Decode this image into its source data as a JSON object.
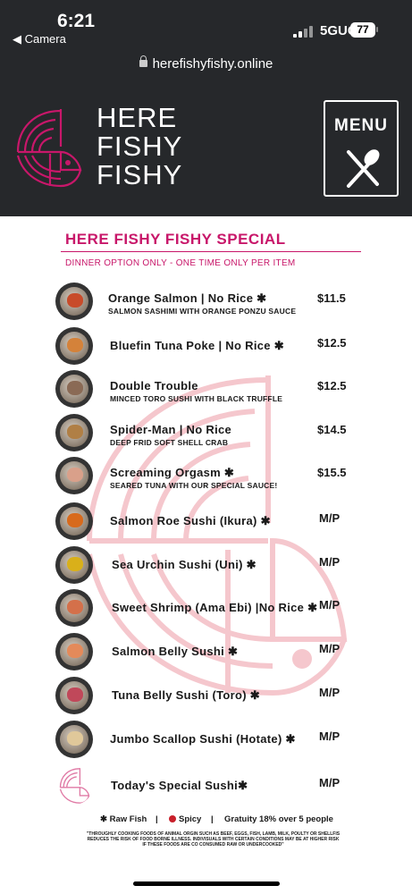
{
  "status": {
    "time": "6:21",
    "back_label": "◀ Camera",
    "network": "5GUC",
    "battery": "77"
  },
  "browser": {
    "url": "herefishyfishy.online"
  },
  "header": {
    "brand_lines": [
      "HERE",
      "FISHY",
      "FISHY"
    ],
    "menu_label": "MENU"
  },
  "section": {
    "title": "HERE FISHY FISHY SPECIAL",
    "subtitle": "DINNER OPTION ONLY - ONE TIME ONLY PER ITEM"
  },
  "items": [
    {
      "name": "Orange Salmon  |  No Rice ✱",
      "desc": "SALMON SASHIMI WITH ORANGE PONZU SAUCE",
      "price": "$11.5",
      "plate": "#c84b2a"
    },
    {
      "name": "Bluefin Tuna Poke  |  No Rice ✱",
      "desc": "",
      "price": "$12.5",
      "plate": "#d4823a"
    },
    {
      "name": "Double Trouble",
      "desc": "MINCED TORO SUSHI WITH BLACK TRUFFLE",
      "price": "$12.5",
      "plate": "#8a6a55"
    },
    {
      "name": "Spider-Man  |  No Rice",
      "desc": "DEEP FRID SOFT SHELL CRAB",
      "price": "$14.5",
      "plate": "#b07f45"
    },
    {
      "name": "Screaming Orgasm  ✱",
      "desc": "SEARED TUNA WITH OUR SPECIAL SAUCE!",
      "price": "$15.5",
      "plate": "#d9a08a"
    },
    {
      "name": "Salmon Roe Sushi (Ikura) ✱",
      "desc": "",
      "price": "M/P",
      "plate": "#d86a1c"
    },
    {
      "name": "Sea Urchin Sushi (Uni) ✱",
      "desc": "",
      "price": "M/P",
      "plate": "#d9b01a"
    },
    {
      "name": "Sweet Shrimp (Ama Ebi)  |No Rice  ✱",
      "desc": "",
      "price": "M/P",
      "plate": "#d4704a"
    },
    {
      "name": "Salmon Belly Sushi  ✱",
      "desc": "",
      "price": "M/P",
      "plate": "#e48a5a"
    },
    {
      "name": "Tuna Belly Sushi (Toro)  ✱",
      "desc": "",
      "price": "M/P",
      "plate": "#c0485a"
    },
    {
      "name": "Jumbo Scallop Sushi (Hotate) ✱",
      "desc": "",
      "price": "M/P",
      "plate": "#e0c89a"
    },
    {
      "name": "Today's Special Sushi✱",
      "desc": "",
      "price": "M/P",
      "plate": "logo"
    }
  ],
  "footer": {
    "raw_fish": "✱ Raw Fish",
    "sep1": "|",
    "spicy": "Spicy",
    "sep2": "|",
    "gratuity": "Gratuity 18% over 5 people",
    "disclaimer": "\"THROUGHLY COOKING FOODS OF ANIMAL ORGIN SUCH AS BEEF, EGGS, FISH, LAMB, MILK, POULTY OR SHELLFIS REDUCES THE RISK OF FOOD BORNE ILLNESS. INDIVISUALS WITH CERTAIN CONDITIONS MAY BE AT HIGHER RISK IF THESE FOODS ARE CO CONSUMED RAW OR UNDERCOOKED\""
  },
  "colors": {
    "brand_pink": "#c8176a",
    "header_bg": "#26282b",
    "spicy_red": "#c81f2a"
  }
}
